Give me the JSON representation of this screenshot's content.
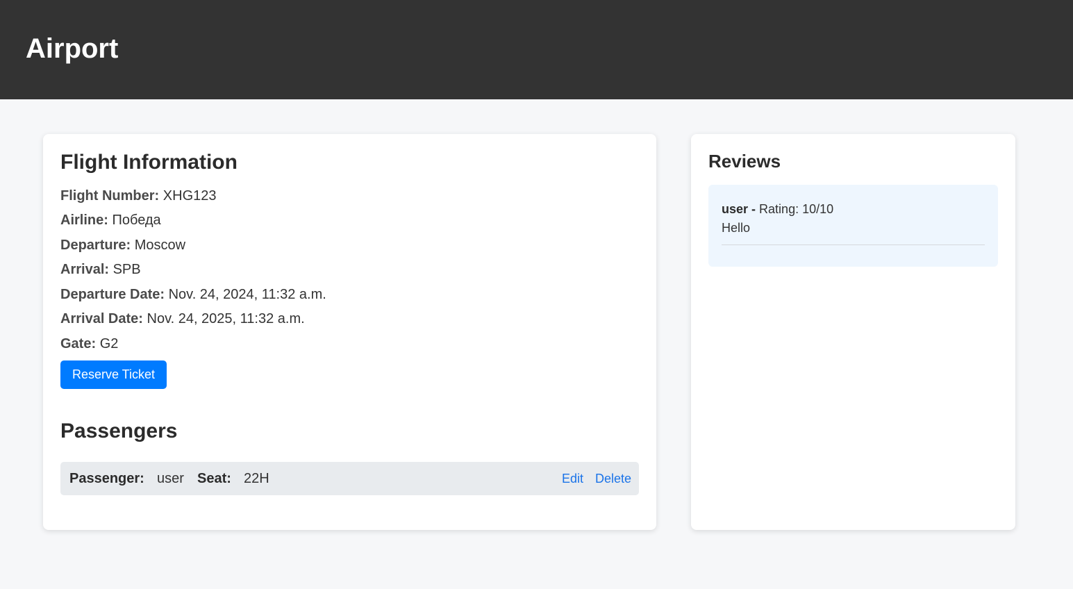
{
  "header": {
    "title": "Airport"
  },
  "flight": {
    "title": "Flight Information",
    "fields": [
      {
        "label": "Flight Number:",
        "value": "XHG123"
      },
      {
        "label": "Airline:",
        "value": "Победа"
      },
      {
        "label": "Departure:",
        "value": "Moscow"
      },
      {
        "label": "Arrival:",
        "value": "SPB"
      },
      {
        "label": "Departure Date:",
        "value": "Nov. 24, 2024, 11:32 a.m."
      },
      {
        "label": "Arrival Date:",
        "value": "Nov. 24, 2025, 11:32 a.m."
      },
      {
        "label": "Gate:",
        "value": "G2"
      }
    ],
    "reserve_label": "Reserve Ticket"
  },
  "passengers": {
    "title": "Passengers",
    "rows": [
      {
        "passenger_label": "Passenger:",
        "passenger_value": "user",
        "seat_label": "Seat:",
        "seat_value": "22H",
        "edit_label": "Edit",
        "delete_label": "Delete"
      }
    ]
  },
  "reviews": {
    "title": "Reviews",
    "items": [
      {
        "user": "user -",
        "rating": "Rating: 10/10",
        "text": "Hello"
      }
    ]
  },
  "colors": {
    "header_bg": "#333333",
    "page_bg": "#f6f7f9",
    "primary_button": "#007bff",
    "link": "#1a73e8",
    "passenger_row_bg": "#e8ebee",
    "review_bg": "#eef6fe"
  }
}
